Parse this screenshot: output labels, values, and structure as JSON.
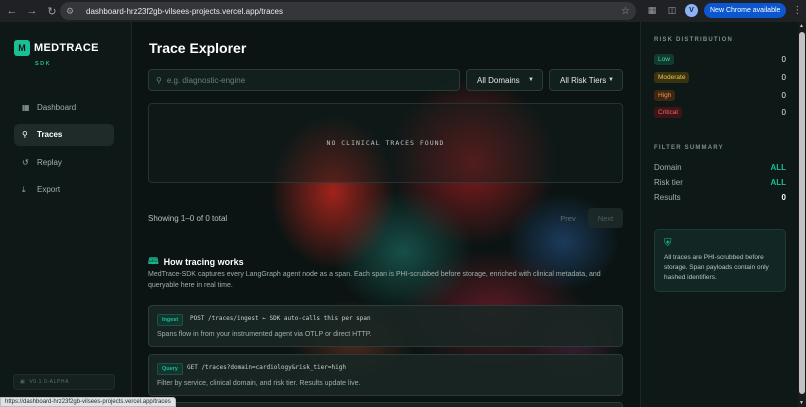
{
  "browser": {
    "url": "dashboard-hrz23f2gb-vilsees-projects.vercel.app/traces",
    "avatar_letter": "V",
    "update_label": "New Chrome available",
    "icons": [
      "back-icon",
      "forward-icon",
      "reload-icon",
      "site-settings-icon",
      "star-icon",
      "extensions-icon",
      "sidebar-icon",
      "kebab-icon"
    ]
  },
  "sidebar": {
    "logo_mark": "M",
    "brand": "MEDTRACE",
    "brand_sub": "SDK",
    "items": [
      {
        "label": "Dashboard",
        "icon": "grid-icon"
      },
      {
        "label": "Traces",
        "icon": "search-icon",
        "active": true
      },
      {
        "label": "Replay",
        "icon": "replay-icon"
      },
      {
        "label": "Export",
        "icon": "download-icon"
      }
    ],
    "version": "V0.1.0-ALPHA"
  },
  "main": {
    "title": "Trace Explorer",
    "search_placeholder": "e.g. diagnostic-engine",
    "domain_select": "All Domains",
    "risk_select": "All Risk Tiers",
    "empty_message": "NO CLINICAL TRACES FOUND",
    "showing": "Showing 1–0 of 0 total",
    "prev_label": "Prev",
    "next_label": "Next",
    "how_title": "How tracing works",
    "how_desc": "MedTrace-SDK captures every LangGraph agent node as a span. Each span is PHI-scrubbed before storage, enriched with clinical metadata, and queryable here in real time.",
    "cards": [
      {
        "tag": "Ingest",
        "endpoint": "POST /traces/ingest ← SDK auto-calls this per span",
        "desc": "Spans flow in from your instrumented agent via OTLP or direct HTTP."
      },
      {
        "tag": "Query",
        "endpoint": "GET /traces?domain=cardiology&risk_tier=high",
        "desc": "Filter by service, clinical domain, and risk tier. Results update live."
      }
    ]
  },
  "right_panel": {
    "risk_heading": "RISK DISTRIBUTION",
    "risks": [
      {
        "label": "Low",
        "count": "0",
        "color": "#3fd9a3"
      },
      {
        "label": "Moderate",
        "count": "0",
        "color": "#e9c64a"
      },
      {
        "label": "High",
        "count": "0",
        "color": "#f0954a"
      },
      {
        "label": "Critical",
        "count": "0",
        "color": "#ef6464"
      }
    ],
    "filter_heading": "FILTER SUMMARY",
    "filters": [
      {
        "key": "Domain",
        "value": "ALL"
      },
      {
        "key": "Risk tier",
        "value": "ALL"
      },
      {
        "key": "Results",
        "value": "0"
      }
    ],
    "info_text": "All traces are PHI-scrubbed before storage. Span payloads contain only hashed identifiers."
  },
  "status_bar_url": "https://dashboard-hrz23f2gb-vilsees-projects.vercel.app/traces",
  "colors": {
    "accent": "#1bbf95",
    "background": "#0b1413",
    "panel": "#0d1817"
  }
}
